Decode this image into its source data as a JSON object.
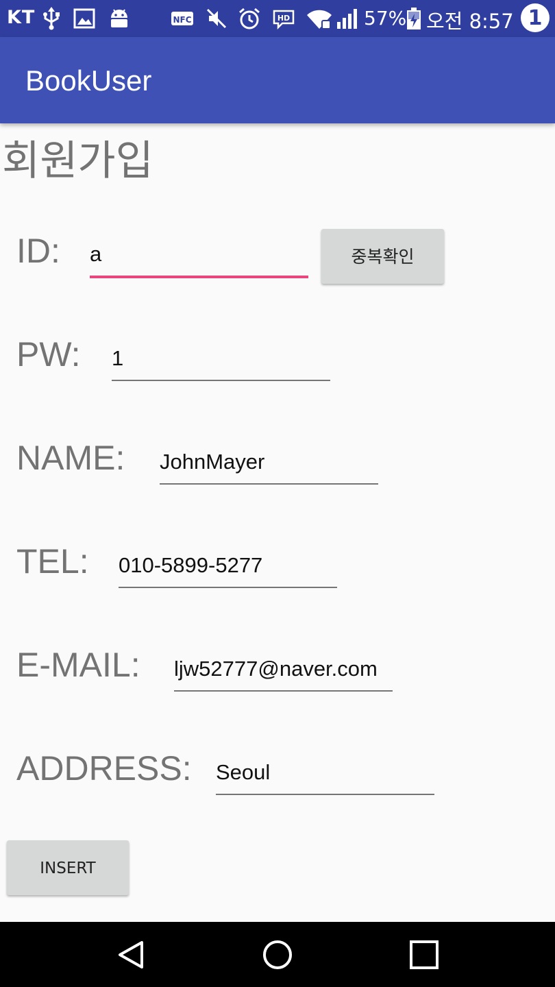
{
  "status_bar": {
    "carrier": "KT",
    "battery_percent": "57%",
    "time": "오전 8:57",
    "notification_count": "1",
    "icons": [
      "usb-icon",
      "image-icon",
      "android-icon",
      "nfc-icon",
      "mute-icon",
      "alarm-icon",
      "hd-voice-icon",
      "wifi-icon",
      "signal-icon",
      "battery-charging-icon"
    ]
  },
  "app_bar": {
    "title": "BookUser",
    "color": "#3f51b5"
  },
  "form": {
    "heading": "회원가입",
    "id": {
      "label": "ID:",
      "value": "a"
    },
    "duplicate_check_button": "중복확인",
    "pw": {
      "label": "PW:",
      "value": "1"
    },
    "name": {
      "label": "NAME:",
      "value": "JohnMayer"
    },
    "tel": {
      "label": "TEL:",
      "value": "010-5899-5277"
    },
    "email": {
      "label": "E-MAIL:",
      "value": "ljw52777@naver.com"
    },
    "address": {
      "label": "ADDRESS:",
      "value": "Seoul"
    },
    "insert_button": "INSERT",
    "accent_color": "#e8467c"
  },
  "nav_bar": {
    "icons": [
      "back-icon",
      "home-icon",
      "recents-icon"
    ]
  }
}
